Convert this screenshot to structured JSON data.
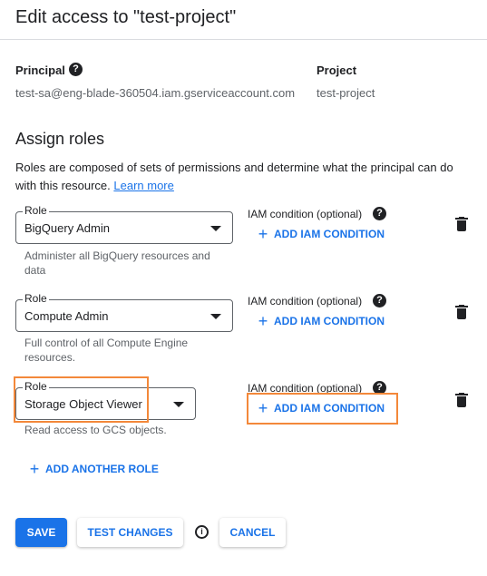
{
  "dialog": {
    "title": "Edit access to \"test-project\""
  },
  "principal": {
    "label": "Principal",
    "help_icon": "?",
    "value": "test-sa@eng-blade-360504.iam.gserviceaccount.com"
  },
  "project": {
    "label": "Project",
    "value": "test-project"
  },
  "assign": {
    "title": "Assign roles",
    "description": "Roles are composed of sets of permissions and determine what the principal can do with this resource.",
    "learn_more": "Learn more"
  },
  "roles": [
    {
      "field_label": "Role",
      "value": "BigQuery Admin",
      "hint": "Administer all BigQuery resources and data",
      "condition_label": "IAM condition (optional)",
      "condition_help": "?",
      "add_condition_label": "ADD IAM CONDITION"
    },
    {
      "field_label": "Role",
      "value": "Compute Admin",
      "hint": "Full control of all Compute Engine resources.",
      "condition_label": "IAM condition (optional)",
      "condition_help": "?",
      "add_condition_label": "ADD IAM CONDITION"
    },
    {
      "field_label": "Role",
      "value": "Storage Object Viewer",
      "hint": "Read access to GCS objects.",
      "condition_label": "IAM condition (optional)",
      "condition_help": "?",
      "add_condition_label": "ADD IAM CONDITION"
    }
  ],
  "add_role_label": "ADD ANOTHER ROLE",
  "plus_glyph": "+",
  "info_glyph": "i",
  "footer": {
    "save": "SAVE",
    "test_changes": "TEST CHANGES",
    "cancel": "CANCEL"
  },
  "colors": {
    "accent": "#1a73e8",
    "highlight": "#f3883a",
    "text": "#202124",
    "muted": "#5f6368"
  }
}
